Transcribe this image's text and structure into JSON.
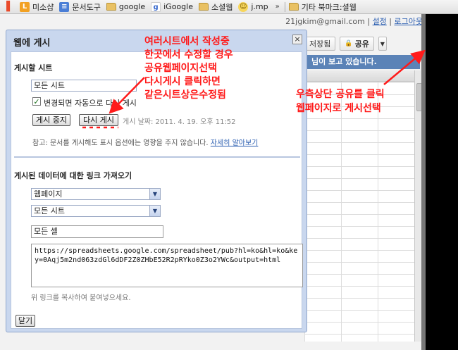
{
  "bookmarks": [
    {
      "label": "",
      "icon": "mail-icon"
    },
    {
      "label": "미소샵",
      "icon": "shop-icon"
    },
    {
      "label": "문서도구",
      "icon": "docs-icon"
    },
    {
      "label": "google",
      "icon": "folder-icon"
    },
    {
      "label": "iGoogle",
      "icon": "google-icon"
    },
    {
      "label": "소셜웹",
      "icon": "folder-icon"
    },
    {
      "label": "j.mp",
      "icon": "face-icon"
    },
    {
      "label": "기타 북마크",
      "icon": "folder-icon"
    }
  ],
  "bookmarks_more": "»",
  "other_bookmarks_tail": ":셜웹",
  "header": {
    "email": "21jgkim@gmail.com",
    "settings": "설정",
    "logout": "로그아웃"
  },
  "toolbar": {
    "saved_label": "저장됨",
    "share_label": "공유"
  },
  "banner_text": "님이 보고 있습니다.",
  "dialog": {
    "title": "웹에 게시",
    "close": "×",
    "publish_section": "게시할 시트",
    "sheet_select": "모든 시트",
    "auto_republish": "변경되면 자동으로 다시 게시",
    "stop_button": "게시 중지",
    "republish_button": "다시 게시",
    "publish_date": "게시 날짜: 2011. 4. 19. 오후 11:52",
    "note_text": "참고: 문서를 게시해도 표시 옵션에는 영향을 주지 않습니다.",
    "note_link": "자세히 알아보기",
    "link_section": "게시된 데이터에 대한 링크 가져오기",
    "format_select": "웹페이지",
    "sheet_select2": "모든 시트",
    "cells_value": "모든 셀",
    "url": "https://spreadsheets.google.com/spreadsheet/pub?hl=ko&hl=ko&key=0Aqj5m2nd063zdGl6dDF2Z0ZHbE52R2pRYko0Z3o2YWc&output=html",
    "copy_hint": "위 링크를 복사하여 붙여넣으세요.",
    "close_button": "닫기"
  },
  "annotations": {
    "left": [
      "여러시트에서 작성중",
      "한곳에서 수정할 경우",
      "공유웹페이지선택",
      "다시게시 클릭하면",
      "같은시트상은수정됨"
    ],
    "right": [
      "우측상단 공유를 클릭",
      "웹페이지로 게시선택"
    ],
    "color": "#ff1a1a"
  }
}
